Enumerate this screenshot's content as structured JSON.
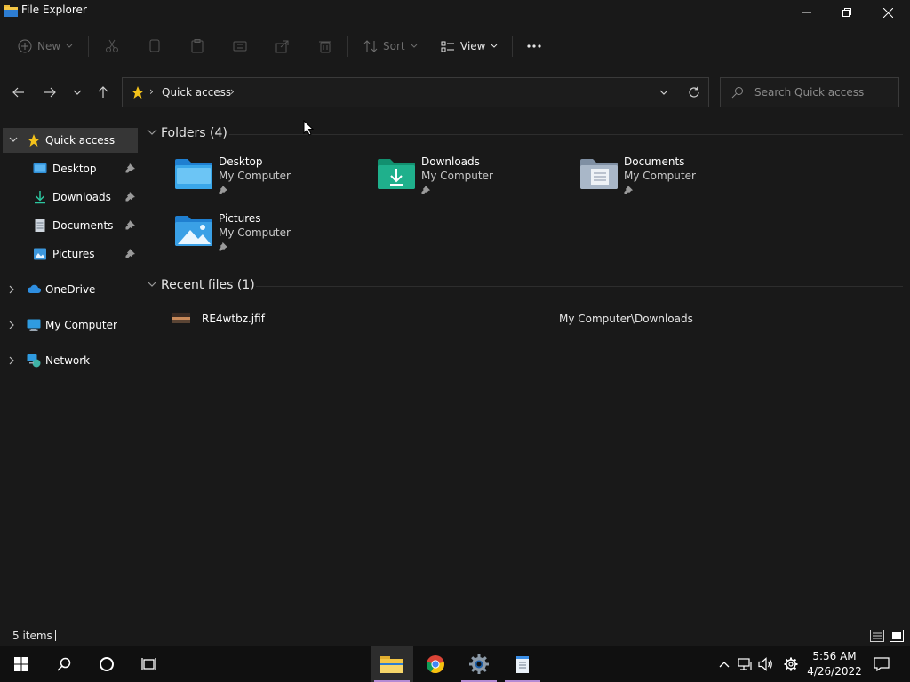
{
  "window": {
    "title": "File Explorer",
    "controls": [
      "minimize",
      "restore",
      "close"
    ]
  },
  "toolbar": {
    "new_label": "New",
    "sort_label": "Sort",
    "view_label": "View",
    "disabled_actions": [
      "cut",
      "copy",
      "paste",
      "rename",
      "share",
      "delete"
    ]
  },
  "address": {
    "crumb": "Quick access",
    "search_placeholder": "Search Quick access"
  },
  "sidebar": {
    "quick_access": "Quick access",
    "items": [
      {
        "label": "Desktop",
        "icon": "desktop-icon",
        "pinned": true
      },
      {
        "label": "Downloads",
        "icon": "download-icon",
        "pinned": true
      },
      {
        "label": "Documents",
        "icon": "document-icon",
        "pinned": true
      },
      {
        "label": "Pictures",
        "icon": "pictures-icon",
        "pinned": true
      }
    ],
    "roots": [
      {
        "label": "OneDrive",
        "icon": "cloud-icon"
      },
      {
        "label": "My Computer",
        "icon": "computer-icon"
      },
      {
        "label": "Network",
        "icon": "network-icon"
      }
    ]
  },
  "content": {
    "folders_header": "Folders (4)",
    "folders": [
      {
        "name": "Desktop",
        "location": "My Computer"
      },
      {
        "name": "Downloads",
        "location": "My Computer"
      },
      {
        "name": "Documents",
        "location": "My Computer"
      },
      {
        "name": "Pictures",
        "location": "My Computer"
      }
    ],
    "recent_header": "Recent files (1)",
    "recent_files": [
      {
        "name": "RE4wtbz.jfif",
        "path": "My Computer\\Downloads"
      }
    ]
  },
  "status": {
    "item_count": "5 items"
  },
  "taskbar": {
    "apps": [
      "File Explorer",
      "Chrome",
      "Settings",
      "Notepad"
    ],
    "time": "5:56 AM",
    "date": "4/26/2022"
  },
  "colors": {
    "folder_blue": "#3aa0e6",
    "downloads_teal": "#1fb08c",
    "quick_access_star": "#f4c21a",
    "taskbar_accent": "#b48ad4"
  }
}
